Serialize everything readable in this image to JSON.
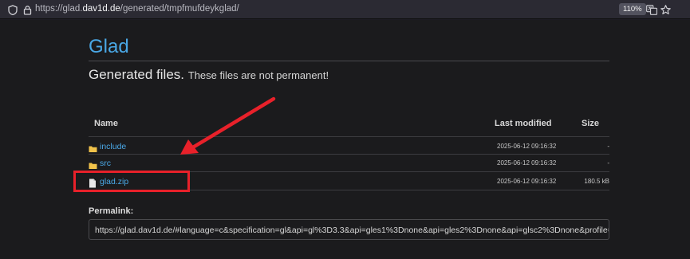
{
  "browser": {
    "url_prefix": "https://glad.",
    "url_domain": "dav1d.de",
    "url_path": "/generated/tmpfmufdeykglad/",
    "zoom": "110%"
  },
  "page": {
    "title": "Glad",
    "subtitle_main": "Generated files.",
    "subtitle_note": "These files are not permanent!"
  },
  "table": {
    "headers": {
      "name": "Name",
      "modified": "Last modified",
      "size": "Size"
    },
    "rows": [
      {
        "name": "include",
        "modified": "2025-06-12 09:16:32",
        "size": "-",
        "icon": "folder-icon"
      },
      {
        "name": "src",
        "modified": "2025-06-12 09:16:32",
        "size": "-",
        "icon": "folder-icon"
      },
      {
        "name": "glad.zip",
        "modified": "2025-06-12 09:16:32",
        "size": "180.5 kB",
        "icon": "file-icon"
      }
    ]
  },
  "permalink": {
    "label": "Permalink:",
    "value": "https://glad.dav1d.de/#language=c&specification=gl&api=gl%3D3.3&api=gles1%3Dnone&api=gles2%3Dnone&api=glsc2%3Dnone&profile="
  },
  "colors": {
    "link": "#4aa8e6",
    "annotation": "#e8212a",
    "background": "#1b1b1d"
  }
}
